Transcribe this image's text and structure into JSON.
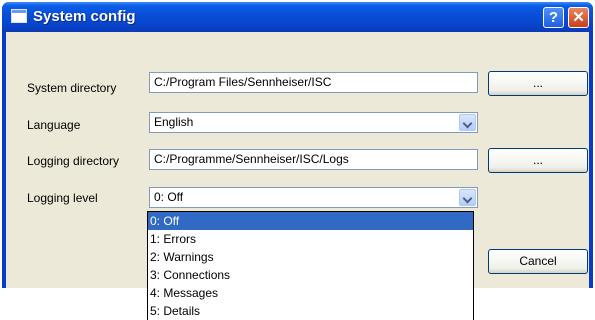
{
  "window": {
    "title": "System config",
    "help_symbol": "?",
    "close_symbol": "✕"
  },
  "form": {
    "system_directory": {
      "label": "System directory",
      "value": "C:/Program Files/Sennheiser/ISC",
      "browse_label": "..."
    },
    "language": {
      "label": "Language",
      "value": "English"
    },
    "logging_directory": {
      "label": "Logging directory",
      "value": "C:/Programme/Sennheiser/ISC/Logs",
      "browse_label": "..."
    },
    "logging_level": {
      "label": "Logging level",
      "value": "0: Off",
      "options": [
        "0: Off",
        "1: Errors",
        "2: Warnings",
        "3: Connections",
        "4: Messages",
        "5: Details"
      ],
      "highlighted_index": 0
    },
    "cancel_label": "Cancel"
  },
  "colors": {
    "titlebar": "#0a4fd8",
    "client": "#ece9d8",
    "selection": "#316ac5",
    "close": "#c8401b"
  }
}
